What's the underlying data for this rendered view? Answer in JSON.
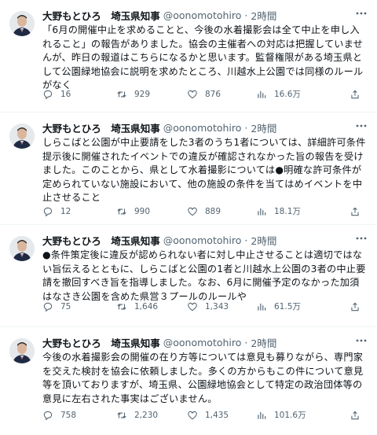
{
  "tweets": [
    {
      "name": "大野もとひろ　埼玉県知事",
      "handle": "@oonomotohiro",
      "time": "2時間",
      "text": "「6月の開催中止を求めることと、今後の水着撮影会は全て中止を申し入れること」の報告がありました。協会の主催者への対応は把握していませんが、昨日の報道はこちらになるかと思います。監督権限がある埼玉県として公園緑地協会に説明を求めたところ、川越水上公園では同様のルールがなく",
      "replies": "16",
      "retweets": "929",
      "likes": "876",
      "views": "16.6万"
    },
    {
      "name": "大野もとひろ　埼玉県知事",
      "handle": "@oonomotohiro",
      "time": "2時間",
      "text": "しらこばと公園が中止要請をした3者のうち1者については、詳細許可条件提示後に開催されたイベントでの違反が確認されなかった旨の報告を受けました。このことから、県として水着撮影については●明確な許可条件が定められていない施設において、他の施設の条件を当てはめイベントを中止させること",
      "replies": "12",
      "retweets": "990",
      "likes": "889",
      "views": "18.1万"
    },
    {
      "name": "大野もとひろ　埼玉県知事",
      "handle": "@oonomotohiro",
      "time": "2時間",
      "text": "●条件策定後に違反が認められない者に対し中止させることは適切ではない旨伝えるとともに、しらこばと公園の1者と川越水上公園の3者の中止要請を撤回すべき旨を指導しました。なお、6月に開催予定のなかった加須はなさき公園を含めた県営３プールのルールや",
      "replies": "75",
      "retweets": "1,646",
      "likes": "1,343",
      "views": "61.5万"
    },
    {
      "name": "大野もとひろ　埼玉県知事",
      "handle": "@oonomotohiro",
      "time": "2時間",
      "text": "今後の水着撮影会の開催の在り方等については意見も募りながら、専門家を交えた検討を協会に依頼しました。多くの方からもこの件について意見等を頂いておりますが、埼玉県、公園緑地協会として特定の政治団体等の意見に左右された事実はございません。",
      "replies": "758",
      "retweets": "2,230",
      "likes": "1,435",
      "views": "101.6万"
    }
  ],
  "colors": {
    "muted": "#536471",
    "text": "#0f1419",
    "divider": "#eff3f4"
  }
}
